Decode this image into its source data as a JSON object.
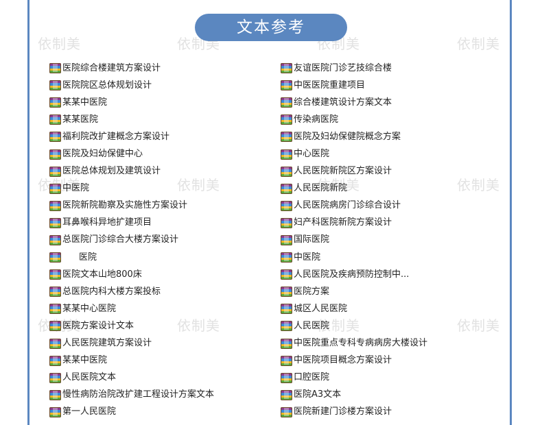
{
  "header": {
    "title": "文本参考"
  },
  "watermark": {
    "text": "依制美"
  },
  "colors": {
    "accent": "#5b87c0",
    "text": "#222222",
    "watermark": "#e2e2e2"
  },
  "icon": "archive-file-icon",
  "items": [
    "医院综合楼建筑方案设计",
    "友谊医院门诊艺技综合楼",
    "医院院区总体规划设计",
    "中医医院重建项目",
    "某某中医院",
    "综合楼建筑设计方案文本",
    "某某医院",
    "传染病医院",
    "福利院改扩建概念方案设计",
    "医院及妇幼保健院概念方案",
    "医院及妇幼保健中心",
    "中心医院",
    "医院总体规划及建筑设计",
    "人民医院新院区方案设计",
    "中医院",
    "人民医院新院",
    "医院新院勘察及实施性方案设计",
    "人民医院病房门诊综合设计",
    "耳鼻喉科异地扩建项目",
    "妇产科医院新院方案设计",
    "总医院门诊综合大楼方案设计",
    "国际医院",
    "医院",
    "中医院",
    "医院文本山地800床",
    "人民医院及疾病预防控制中...",
    "总医院内科大楼方案投标",
    "医院方案",
    "某某中心医院",
    "城区人民医院",
    "医院方案设计文本",
    "人民医院",
    "人民医院建筑方案设计",
    "中医院重点专科专病病房大楼设计",
    "某某中医院",
    "中医院项目概念方案设计",
    "人民医院文本",
    "口腔医院",
    "慢性病防治院改扩建工程设计方案文本",
    "医院A3文本",
    "第一人民医院",
    "医院新建门诊楼方案设计"
  ]
}
